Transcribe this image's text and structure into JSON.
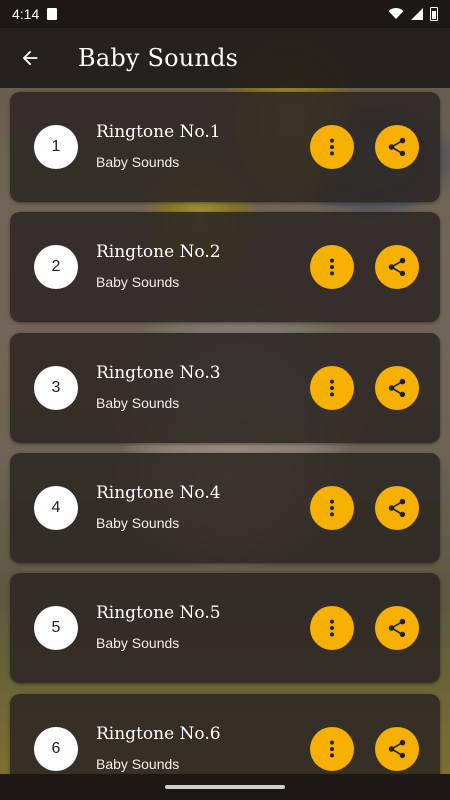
{
  "status_bar": {
    "time": "4:14",
    "icons": [
      "sim-icon",
      "wifi-icon",
      "signal-icon",
      "battery-icon"
    ]
  },
  "app_bar": {
    "title": "Baby Sounds",
    "back_icon": "arrow-left-icon"
  },
  "colors": {
    "accent": "#f5b000",
    "card_bg": "#2c2723",
    "text": "#ffffff"
  },
  "ringtones": [
    {
      "number": "1",
      "title": "Ringtone No.1",
      "subtitle": "Baby Sounds"
    },
    {
      "number": "2",
      "title": "Ringtone No.2",
      "subtitle": "Baby Sounds"
    },
    {
      "number": "3",
      "title": "Ringtone No.3",
      "subtitle": "Baby Sounds"
    },
    {
      "number": "4",
      "title": "Ringtone No.4",
      "subtitle": "Baby Sounds"
    },
    {
      "number": "5",
      "title": "Ringtone No.5",
      "subtitle": "Baby Sounds"
    },
    {
      "number": "6",
      "title": "Ringtone No.6",
      "subtitle": "Baby Sounds"
    }
  ],
  "item_icons": {
    "more": "more-vertical-icon",
    "share": "share-icon"
  }
}
